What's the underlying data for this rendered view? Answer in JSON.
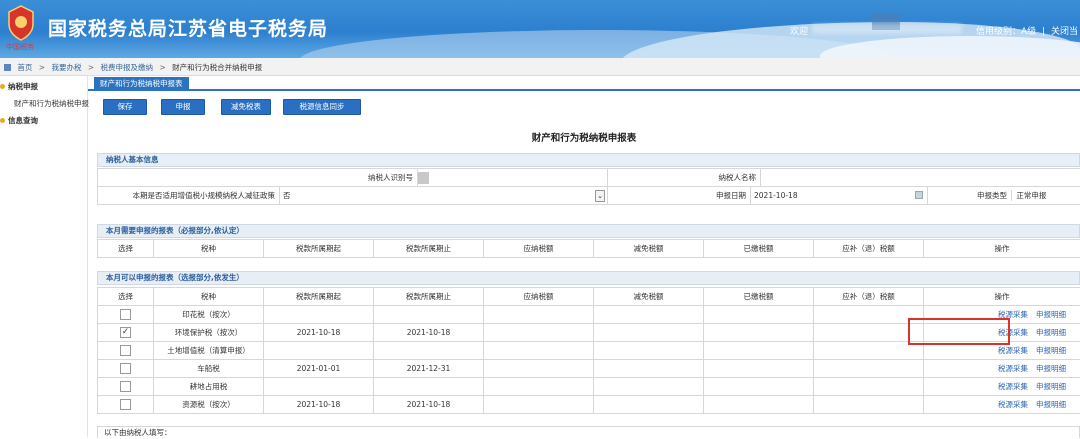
{
  "header": {
    "logo_text": "中国税务",
    "site_title": "国家税务总局江苏省电子税务局",
    "welcome": "欢迎",
    "credit_label": "信用级别：",
    "credit_value": "A级",
    "separator": "|",
    "exit": "关闭当"
  },
  "breadcrumb": [
    "首页",
    "我要办税",
    "税费申报及缴纳",
    "财产和行为税合并纳税申报"
  ],
  "sidebar": {
    "items": [
      {
        "label": "纳税申报",
        "dot_color": "#f0a42a"
      },
      {
        "label": "财产和行为税纳税申报"
      },
      {
        "label": "信息查询",
        "dot_color": "#f0a42a"
      }
    ]
  },
  "tab": {
    "label": "财产和行为税纳税申报表"
  },
  "toolbar": {
    "buttons": [
      "保存",
      "申报",
      "减免税表",
      "税源信息同步"
    ]
  },
  "form_title": "财产和行为税纳税申报表",
  "basic": {
    "title": "纳税人基本信息",
    "taxpayer_id_label": "纳税人识别号",
    "taxpayer_name_label": "纳税人名称",
    "small_scale_label": "本期是否适用增值税小规模纳税人减征政策",
    "small_scale_value": "否",
    "date_label": "申报日期",
    "date_value": "2021-10-18",
    "type_label": "申报类型",
    "type_value": "正常申报"
  },
  "columns": [
    "选择",
    "税种",
    "税款所属期起",
    "税款所属期止",
    "应纳税额",
    "减免税额",
    "已缴税额",
    "应补（退）税额",
    "操作"
  ],
  "required_section": {
    "title": "本月需要申报的报表（必报部分,依认定）"
  },
  "optional_section": {
    "title": "本月可以申报的报表（选报部分,依发生）",
    "rows": [
      {
        "checked": "",
        "tax": "印花税（按次）",
        "start": "",
        "end": "",
        "op1": "税源采集",
        "op2": "申报明细"
      },
      {
        "checked": "✓",
        "tax": "环境保护税（按次）",
        "start": "2021-10-18",
        "end": "2021-10-18",
        "op1": "税源采集",
        "op2": "申报明细"
      },
      {
        "checked": "",
        "tax": "土地增值税（清算申报）",
        "start": "",
        "end": "",
        "op1": "税源采集",
        "op2": "申报明细"
      },
      {
        "checked": "",
        "tax": "车船税",
        "start": "2021-01-01",
        "end": "2021-12-31",
        "op1": "税源采集",
        "op2": "申报明细"
      },
      {
        "checked": "",
        "tax": "耕地占用税",
        "start": "",
        "end": "",
        "op1": "税源采集",
        "op2": "申报明细"
      },
      {
        "checked": "",
        "tax": "资源税（按次）",
        "start": "2021-10-18",
        "end": "2021-10-18",
        "op1": "税源采集",
        "op2": "申报明细"
      }
    ]
  },
  "footer_text": "以下由纳税人填写：",
  "colors": {
    "header_blue": "#2d7fcf",
    "button_blue": "#2b6fc3",
    "link_blue": "#2a64b4",
    "highlight_red": "#d9342b"
  }
}
